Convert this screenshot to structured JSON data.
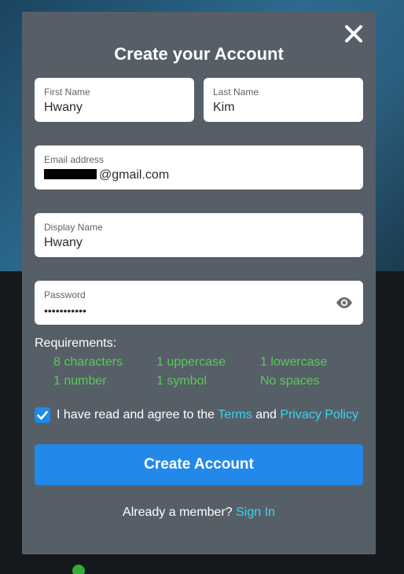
{
  "modal": {
    "title": "Create your Account",
    "close_icon": "close-icon"
  },
  "form": {
    "first_name": {
      "label": "First Name",
      "value": "Hwany"
    },
    "last_name": {
      "label": "Last Name",
      "value": "Kim"
    },
    "email": {
      "label": "Email address",
      "value_suffix": "@gmail.com",
      "redacted": true
    },
    "display_name": {
      "label": "Display Name",
      "value": "Hwany"
    },
    "password": {
      "label": "Password",
      "masked_value": "•••••••••••",
      "toggle_icon": "eye-icon"
    }
  },
  "requirements": {
    "title": "Requirements:",
    "items": [
      "8 characters",
      "1 uppercase",
      "1 lowercase",
      "1 number",
      "1 symbol",
      "No spaces"
    ],
    "color": "#5cc85a"
  },
  "agreement": {
    "checked": true,
    "text_before": "I have read and agree to the",
    "terms_link": "Terms",
    "text_middle": "and",
    "privacy_link": "Privacy Policy"
  },
  "submit": {
    "label": "Create Account"
  },
  "footer": {
    "prompt": "Already a member?",
    "sign_in_link": "Sign In"
  },
  "colors": {
    "modal_bg": "#565f68",
    "primary_button": "#2289ea",
    "link": "#3ad4f1",
    "checkbox": "#1f8ae8"
  }
}
